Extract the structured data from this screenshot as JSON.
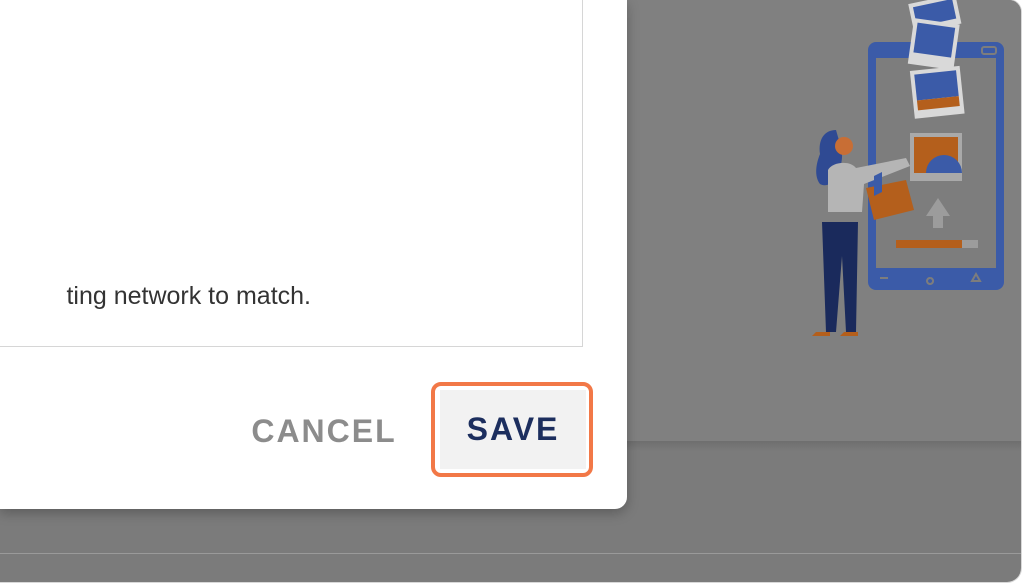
{
  "dialog": {
    "text_fragment": "ting network to match.",
    "buttons": {
      "cancel_label": "CANCEL",
      "save_label": "SAVE"
    }
  },
  "colors": {
    "overlay": "#7b7b7b",
    "save_text": "#1c2e5e",
    "cancel_text": "#8c8c8c",
    "highlight": "#f27847"
  },
  "icons": [
    "person-with-phone-illustration"
  ]
}
